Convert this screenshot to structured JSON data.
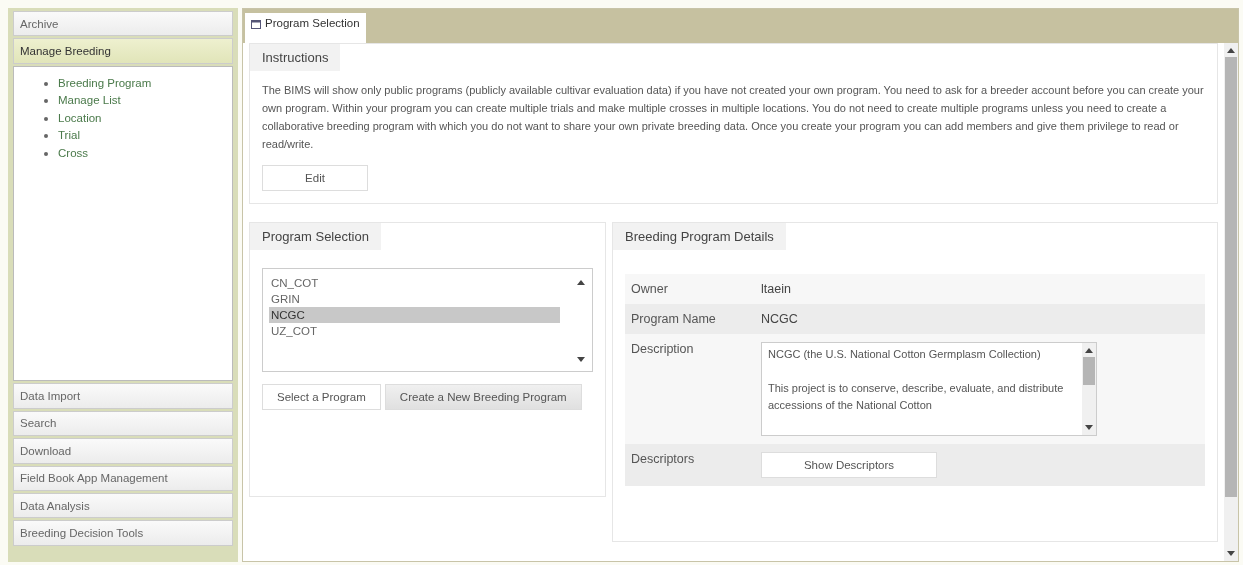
{
  "sidebar": {
    "sections": [
      {
        "label": "Archive",
        "expanded": false
      },
      {
        "label": "Manage Breeding",
        "expanded": true,
        "items": [
          "Breeding Program",
          "Manage List",
          "Location",
          "Trial",
          "Cross"
        ]
      },
      {
        "label": "Data Import",
        "expanded": false
      },
      {
        "label": "Search",
        "expanded": false
      },
      {
        "label": "Download",
        "expanded": false
      },
      {
        "label": "Field Book App Management",
        "expanded": false
      },
      {
        "label": "Data Analysis",
        "expanded": false
      },
      {
        "label": "Breeding Decision Tools",
        "expanded": false
      }
    ]
  },
  "tabs": [
    {
      "label": "Program Selection",
      "selected": true
    }
  ],
  "instructions": {
    "title": "Instructions",
    "text": "The BIMS will show only public programs (publicly available cultivar evaluation data) if you have not created your own program. You need to ask for a breeder account before you can create your own program. Within your program you can create multiple trials and make multiple crosses in multiple locations. You do not need to create multiple programs unless you need to create a collaborative breeding program with which you do not want to share your own private breeding data. Once you create your program you can add members and give them privilege to read or read/write.",
    "button": "Edit"
  },
  "program_selection": {
    "title": "Program Selection",
    "programs": [
      {
        "label": "CN_COT",
        "selected": false
      },
      {
        "label": "GRIN",
        "selected": false
      },
      {
        "label": "NCGC",
        "selected": true
      },
      {
        "label": "UZ_COT",
        "selected": false
      }
    ],
    "buttons": [
      "Select a Program",
      "Create a New Breeding Program"
    ]
  },
  "details": {
    "title": "Breeding Program Details",
    "rows": [
      {
        "label": "Owner",
        "kind": "text",
        "value": "ltaein"
      },
      {
        "label": "Program Name",
        "kind": "text",
        "value": "NCGC"
      },
      {
        "label": "Description",
        "kind": "textarea",
        "value": "NCGC (the U.S. National Cotton Germplasm Collection)\n\nThis project is to conserve, describe, evaluate, and distribute accessions of the National Cotton"
      },
      {
        "label": "Descriptors",
        "kind": "button",
        "value": "Show Descriptors"
      }
    ]
  }
}
